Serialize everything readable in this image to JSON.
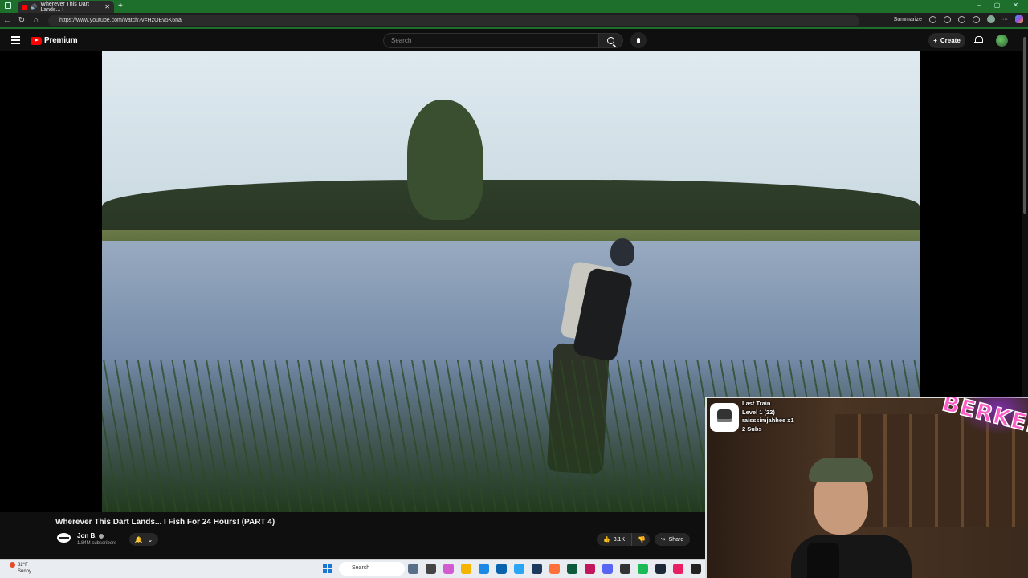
{
  "browser": {
    "tab_title": "Wherever This Dart Lands... I",
    "url": "https://www.youtube.com/watch?v=HzOEv5K6nal",
    "summarize_label": "Summarize"
  },
  "youtube": {
    "logo_label": "Premium",
    "search_placeholder": "Search",
    "create_label": "Create"
  },
  "video": {
    "title": "Wherever This Dart Lands... I Fish For 24 Hours! (PART 4)",
    "channel": "Jon B.",
    "subscribers": "1.84M subscribers",
    "likes": "3.1K",
    "share_label": "Share"
  },
  "stream_overlay": {
    "line1": "Last Train",
    "line2": "Level 1  (22)",
    "line3": "raisssimjahhee x1",
    "line4": "2 Subs",
    "brand_text": "BERKEL"
  },
  "taskbar": {
    "temperature": "82°F",
    "weather": "Sunny",
    "search_label": "Search"
  },
  "colors": {
    "browser_accent": "#1f6f2c",
    "youtube_red": "#ff0000",
    "background": "#0f0f0f"
  }
}
